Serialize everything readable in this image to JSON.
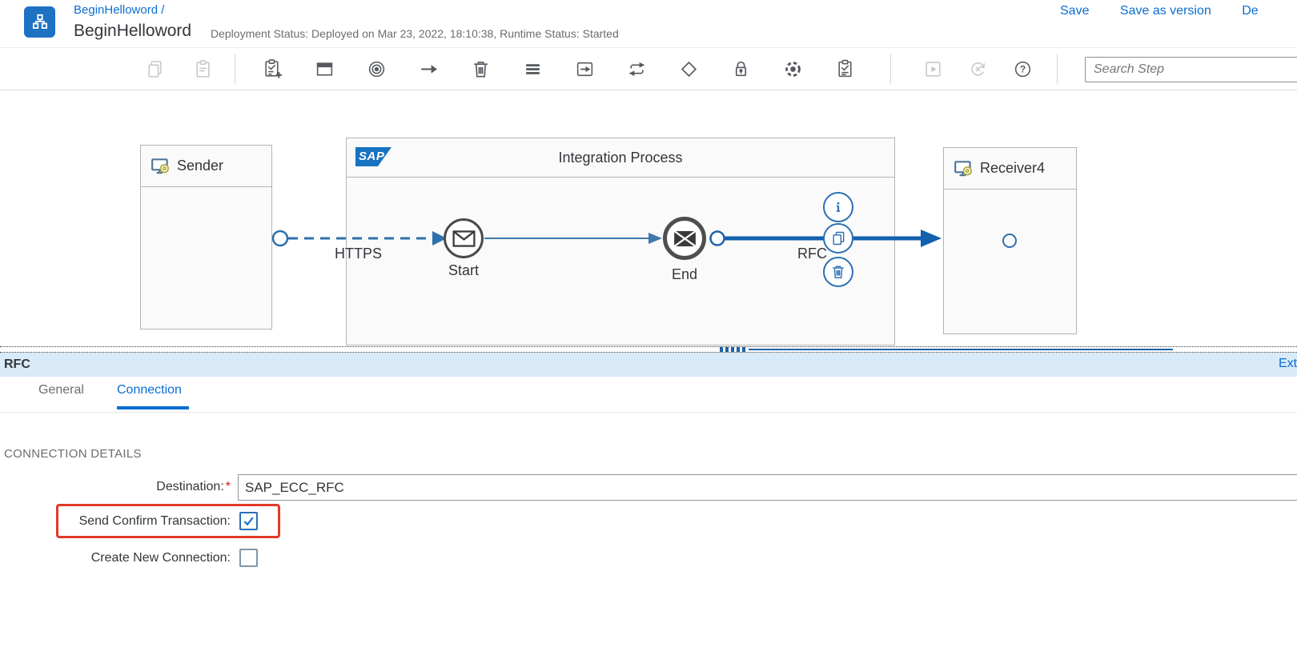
{
  "header": {
    "breadcrumb": "BeginHelloword /",
    "title": "BeginHelloword",
    "status_text": "Deployment Status: Deployed on Mar 23, 2022, 18:10:38, Runtime Status: Started",
    "actions": {
      "save": "Save",
      "save_as_version": "Save as version",
      "deploy_truncated": "De"
    }
  },
  "toolbar": {
    "search_placeholder": "Search Step",
    "help_glyph": "?",
    "icons": [
      "copy",
      "paste",
      "add-task",
      "pool",
      "target",
      "connector-arrow",
      "delete",
      "persistence-menu",
      "external-call",
      "transform",
      "router",
      "security",
      "integration-mesh",
      "validator",
      "simulate-play",
      "cancel-simulation",
      "help"
    ]
  },
  "canvas": {
    "sender": {
      "label": "Sender"
    },
    "integration_process": {
      "logo_text": "SAP",
      "title": "Integration Process",
      "start_label": "Start",
      "end_label": "End"
    },
    "receiver": {
      "label": "Receiver4"
    },
    "https_connection_label": "HTTPS",
    "rfc_connection_label": "RFC"
  },
  "properties_panel": {
    "title": "RFC",
    "externalize_link_truncated": "Ext",
    "tabs": [
      {
        "label": "General",
        "active": false
      },
      {
        "label": "Connection",
        "active": true
      }
    ],
    "section_heading": "CONNECTION DETAILS",
    "fields": {
      "destination": {
        "label": "Destination:",
        "required_marker": "*",
        "value": "SAP_ECC_RFC"
      },
      "send_confirm_transaction": {
        "label": "Send Confirm Transaction:",
        "checked": true,
        "highlighted": true
      },
      "create_new_connection": {
        "label": "Create New Connection:",
        "checked": false
      }
    }
  },
  "colors": {
    "accent_blue": "#0a6ed1",
    "connection_blue": "#1360ae",
    "annotation_red": "#e13a28",
    "panel_header_bg": "#d9eaf9",
    "app_icon_bg": "#1d72c4"
  }
}
